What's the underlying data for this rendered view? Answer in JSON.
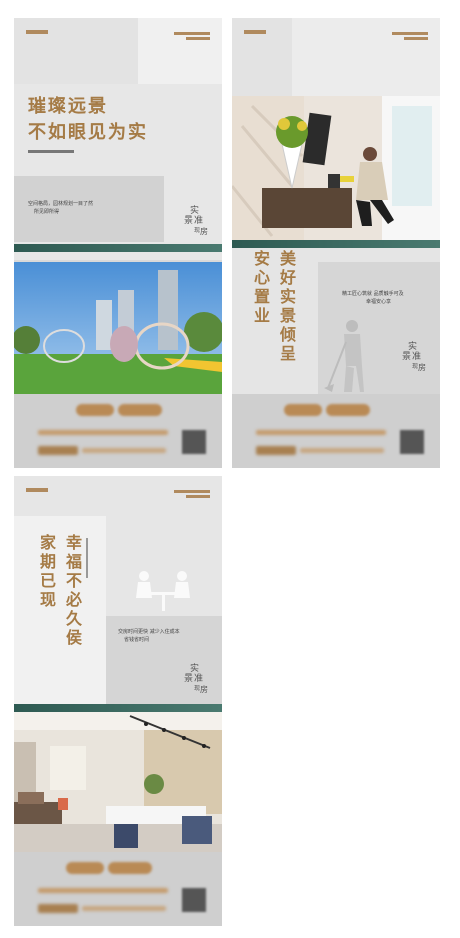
{
  "poster1": {
    "headline_line1": "璀璨远景",
    "headline_line2": "不如眼见为实",
    "bullet_line1": "空间格局，园林规划一目了然",
    "bullet_line2": "所见即所得",
    "stamp": [
      "实",
      "景",
      "准",
      "现",
      "房"
    ]
  },
  "poster2": {
    "vertical_col1": "美好实景倾呈",
    "vertical_col2": "安心置业",
    "bullet_line1": "精工匠心筑就 品质触手可及",
    "bullet_line2": "幸福安心享",
    "stamp": [
      "实",
      "景",
      "准",
      "现",
      "房"
    ]
  },
  "poster3": {
    "vertical_col1": "幸福不必久侯",
    "vertical_col2": "家期已现",
    "bullet_line1": "交房时间更快 减少入住成本",
    "bullet_line2": "省钱省时间",
    "stamp": [
      "实",
      "景",
      "准",
      "现",
      "房"
    ]
  },
  "colors": {
    "accent_gold": "#a57b46",
    "accent_green": "#2e5a52",
    "panel_gray": "#d9d9d9"
  }
}
